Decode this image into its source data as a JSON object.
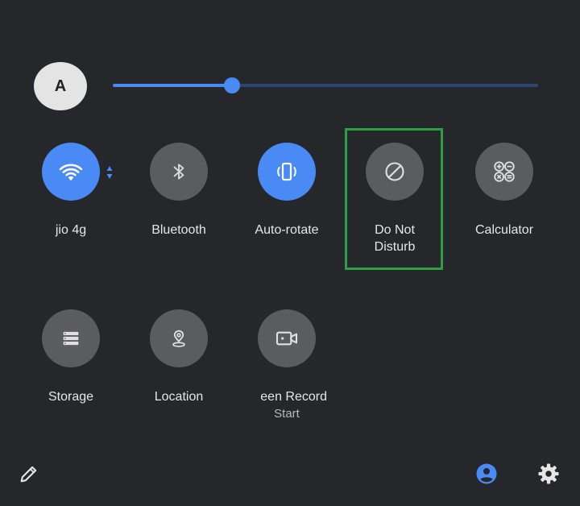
{
  "user": {
    "avatar_letter": "A"
  },
  "brightness": {
    "level": 0.28
  },
  "tiles": [
    {
      "label": "jio 4g",
      "icon": "wifi-icon",
      "active": true
    },
    {
      "label": "Bluetooth",
      "icon": "bluetooth-icon",
      "active": false
    },
    {
      "label": "Auto-rotate",
      "icon": "auto-rotate-icon",
      "active": true
    },
    {
      "label": "Do Not Disturb",
      "icon": "do-not-disturb-icon",
      "active": false
    },
    {
      "label": "Calculator",
      "icon": "calculator-icon",
      "active": false
    },
    {
      "label": "Storage",
      "icon": "storage-icon",
      "active": false
    },
    {
      "label": "Location",
      "icon": "location-icon",
      "active": false
    },
    {
      "label": "een Record",
      "sublabel": "Start",
      "icon": "screen-record-icon",
      "active": false
    }
  ],
  "bottom_bar": {
    "edit_icon": "pencil-icon",
    "user_icon": "account-icon",
    "settings_icon": "gear-icon"
  },
  "colors": {
    "background": "#25272a",
    "accent": "#4a8af4",
    "tile_inactive": "#5a5c60",
    "highlight": "#2e9e45"
  }
}
